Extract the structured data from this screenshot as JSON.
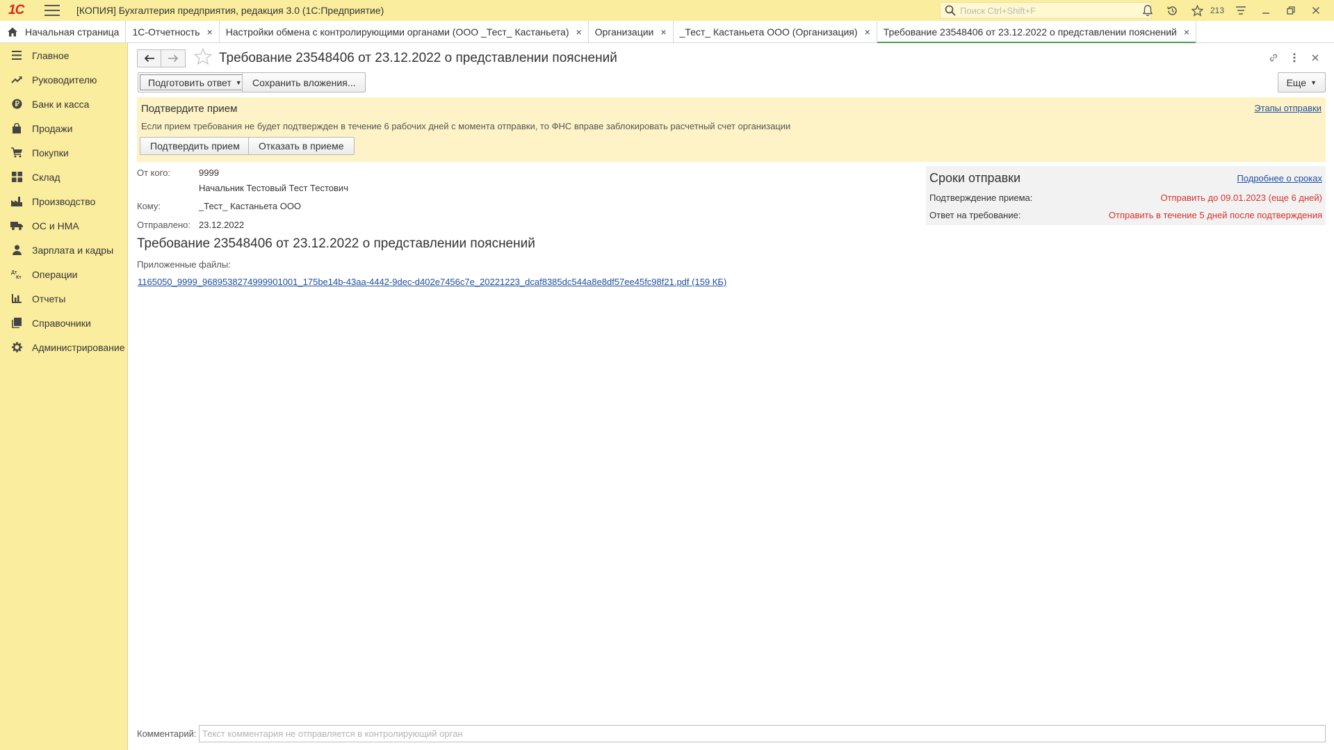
{
  "titlebar": {
    "logo": "1C",
    "title": "[КОПИЯ] Бухгалтерия предприятия, редакция 3.0  (1С:Предприятие)",
    "search_placeholder": "Поиск Ctrl+Shift+F",
    "history_count": "213"
  },
  "tabs": [
    {
      "label": "Начальная страница"
    },
    {
      "label": "1С-Отчетность"
    },
    {
      "label": "Настройки обмена с контролирующими органами (ООО _Тест_ Кастаньета)"
    },
    {
      "label": "Организации"
    },
    {
      "label": "_Тест_ Кастаньета ООО (Организация)"
    },
    {
      "label": "Требование 23548406 от 23.12.2022 о представлении пояснений"
    }
  ],
  "tab_close_glyph": "×",
  "sidebar": {
    "items": [
      {
        "label": "Главное",
        "icon": "menu-lines-icon"
      },
      {
        "label": "Руководителю",
        "icon": "trend-icon"
      },
      {
        "label": "Банк и касса",
        "icon": "ruble-coin-icon"
      },
      {
        "label": "Продажи",
        "icon": "shopping-bag-icon"
      },
      {
        "label": "Покупки",
        "icon": "cart-icon"
      },
      {
        "label": "Склад",
        "icon": "warehouse-grid-icon"
      },
      {
        "label": "Производство",
        "icon": "factory-icon"
      },
      {
        "label": "ОС и НМА",
        "icon": "truck-icon"
      },
      {
        "label": "Зарплата и кадры",
        "icon": "person-icon"
      },
      {
        "label": "Операции",
        "icon": "dt-kt-icon"
      },
      {
        "label": "Отчеты",
        "icon": "bar-chart-icon"
      },
      {
        "label": "Справочники",
        "icon": "books-icon"
      },
      {
        "label": "Администрирование",
        "icon": "gear-icon"
      }
    ]
  },
  "form": {
    "title": "Требование 23548406 от 23.12.2022 о представлении пояснений",
    "prepare_reply_label": "Подготовить ответ",
    "save_attachments_label": "Сохранить вложения...",
    "more_label": "Еще"
  },
  "notice": {
    "title": "Подтвердите прием",
    "link": "Этапы отправки",
    "text": "Если прием требования не будет подтвержден в течение 6 рабочих дней с момента отправки, то ФНС вправе заблокировать расчетный счет организации",
    "confirm_label": "Подтвердить прием",
    "reject_label": "Отказать в приеме"
  },
  "info": {
    "from_label": "От кого:",
    "from_value": "9999",
    "from_person": "Начальник Тестовый Тест Тестович",
    "to_label": "Кому:",
    "to_value": "_Тест_ Кастаньета ООО",
    "sent_label": "Отправлено:",
    "sent_value": "23.12.2022",
    "heading": "Требование 23548406 от 23.12.2022 о представлении пояснений",
    "files_label": "Приложенные файлы:",
    "file_link": "1165050_9999_9689538274999901001_175be14b-43aa-4442-9dec-d402e7456c7e_20221223_dcaf8385dc544a8e8df57ee45fc98f21.pdf (159 КБ)"
  },
  "deadlines": {
    "title": "Сроки отправки",
    "link": "Подробнее о сроках",
    "confirm_label": "Подтверждение приема:",
    "confirm_value": "Отправить до 09.01.2023 (еще 6 дней)",
    "reply_label": "Ответ на требование:",
    "reply_value": "Отправить в течение 5 дней после подтверждения"
  },
  "comment": {
    "label": "Комментарий:",
    "placeholder": "Текст комментария не отправляется в контролирующий орган",
    "value": ""
  },
  "colors": {
    "sidebar_bg": "#fbed9e",
    "notice_bg": "#fdf3c6",
    "link": "#1e4fa3",
    "deadline_red": "#d9312b",
    "active_tab_underline": "#4a9e4f"
  }
}
